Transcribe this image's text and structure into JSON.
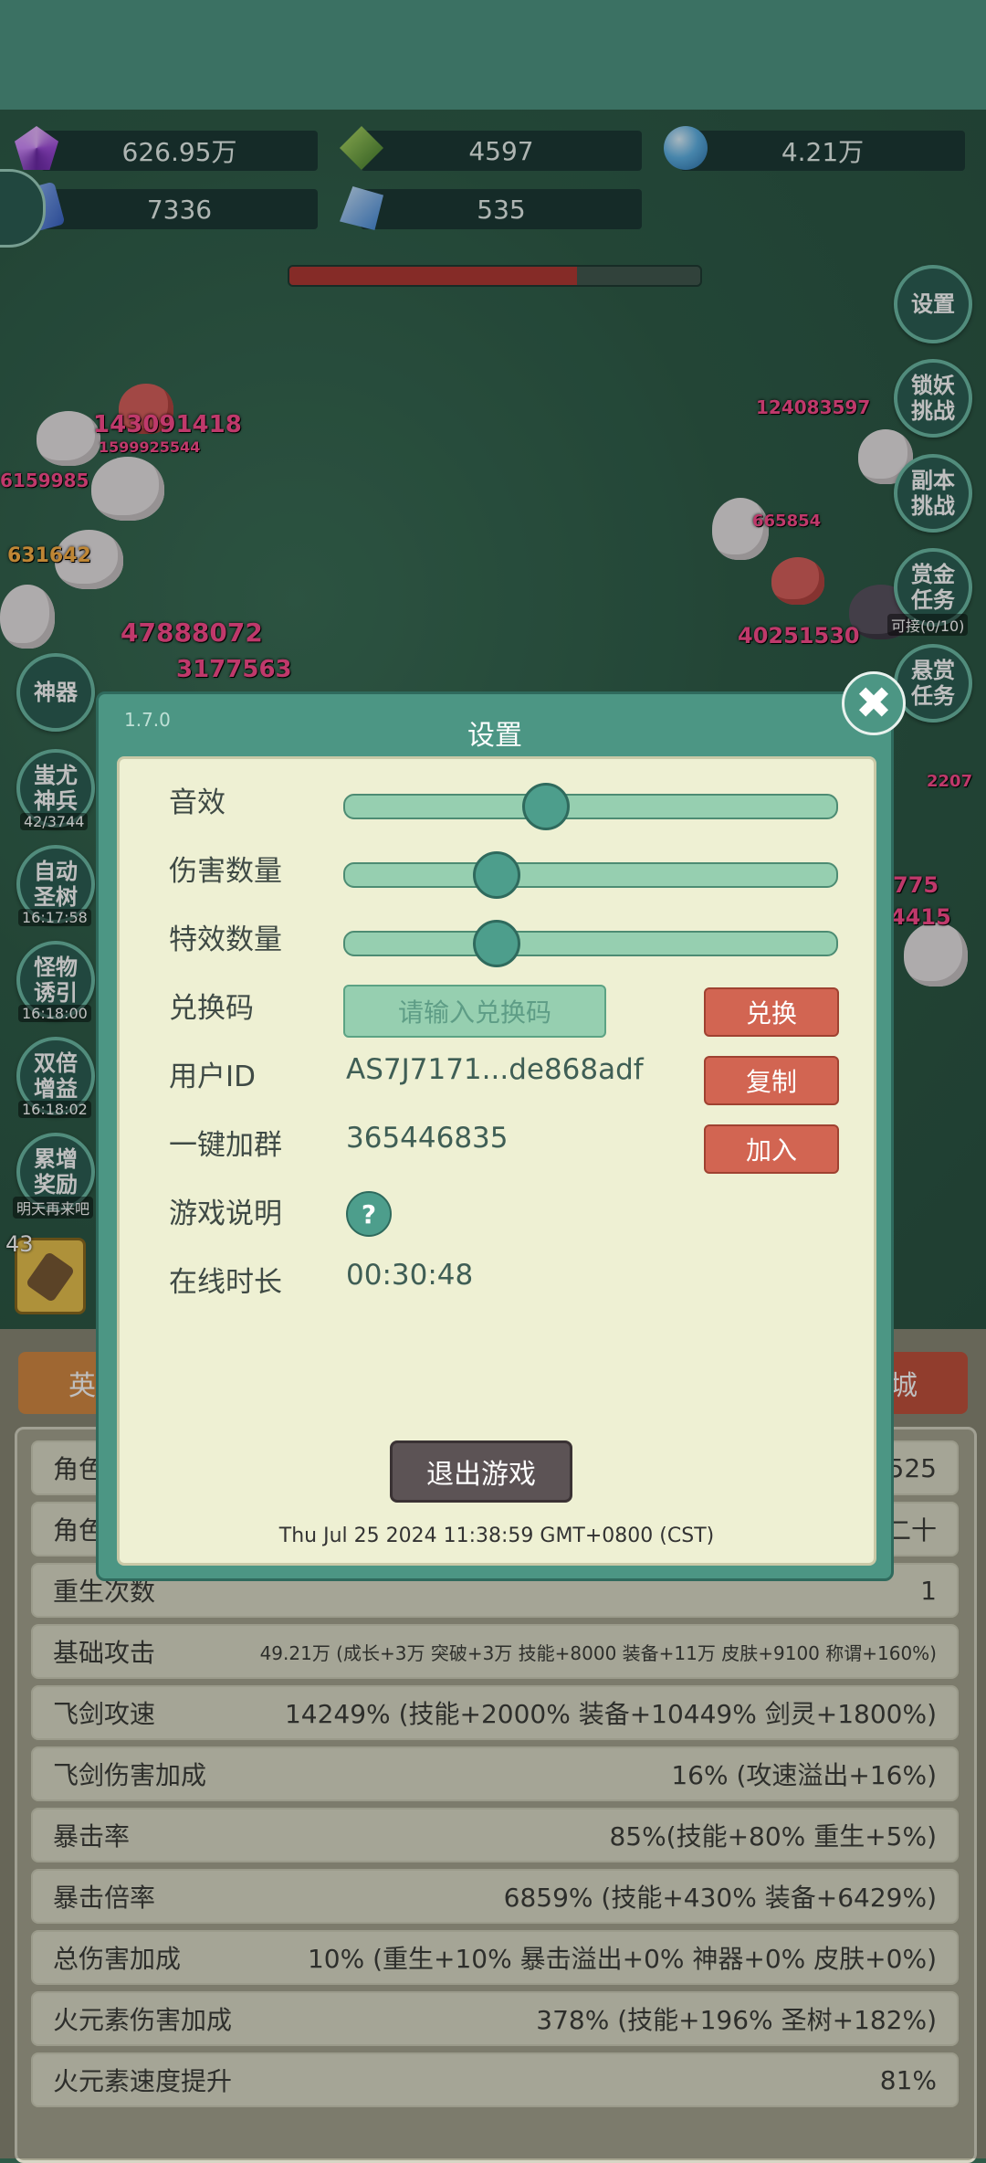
{
  "currencies": [
    {
      "icon": "purple-gem-icon",
      "value": "626.95万"
    },
    {
      "icon": "green-gem-icon",
      "value": "4597"
    },
    {
      "icon": "blue-orb-icon",
      "value": "4.21万"
    },
    {
      "icon": "blue-book-icon",
      "value": "7336"
    },
    {
      "icon": "blue-crystal-icon",
      "value": "535"
    }
  ],
  "boss_hp_fraction": 0.7,
  "side_right": [
    {
      "label": "设置"
    },
    {
      "label": "锁妖\n挑战"
    },
    {
      "label": "副本\n挑战"
    },
    {
      "label": "赏金\n任务",
      "sub": "可接(0/10)"
    },
    {
      "label": "悬赏\n任务"
    }
  ],
  "side_left": [
    {
      "label": "神器"
    },
    {
      "label": "蚩尤\n神兵",
      "sub": "42/3744"
    },
    {
      "label": "自动\n圣树",
      "sub": "16:17:58"
    },
    {
      "label": "怪物\n诱引",
      "sub": "16:18:00"
    },
    {
      "label": "双倍\n增益",
      "sub": "16:18:02"
    },
    {
      "label": "累增\n奖励",
      "sub": "明天再来吧"
    }
  ],
  "damage_numbers": [
    "143091418",
    "124083597",
    "6159985",
    "631642",
    "47888072",
    "3177563",
    "40251530",
    "665854",
    "1599925544",
    "2207",
    "775",
    "4415"
  ],
  "skill_level": "43",
  "tabs": {
    "left": "英",
    "right": "城"
  },
  "stats": [
    {
      "label": "角色",
      "value": "525"
    },
    {
      "label": "角色",
      "value": "二十"
    },
    {
      "label": "重生次数",
      "value": "1"
    },
    {
      "label": "基础攻击",
      "value": "49.21万 (成长+3万 突破+3万 技能+8000 装备+11万 皮肤+9100 称谓+160%)",
      "small": true
    },
    {
      "label": "飞剑攻速",
      "value": "14249% (技能+2000% 装备+10449% 剑灵+1800%)"
    },
    {
      "label": "飞剑伤害加成",
      "value": "16% (攻速溢出+16%)"
    },
    {
      "label": "暴击率",
      "value": "85%(技能+80% 重生+5%)"
    },
    {
      "label": "暴击倍率",
      "value": "6859% (技能+430% 装备+6429%)"
    },
    {
      "label": "总伤害加成",
      "value": "10% (重生+10% 暴击溢出+0% 神器+0% 皮肤+0%)"
    },
    {
      "label": "火元素伤害加成",
      "value": "378% (技能+196% 圣树+182%)"
    },
    {
      "label": "火元素速度提升",
      "value": "81%"
    }
  ],
  "dialog": {
    "version": "1.7.0",
    "title": "设置",
    "sound_label": "音效",
    "sound_level": 0.4,
    "damage_count_label": "伤害数量",
    "damage_count_level": 0.3,
    "effects_count_label": "特效数量",
    "effects_count_level": 0.3,
    "redeem_label": "兑换码",
    "redeem_placeholder": "请输入兑换码",
    "redeem_button": "兑换",
    "user_id_label": "用户ID",
    "user_id": "AS7J7171...de868adf",
    "copy_button": "复制",
    "group_label": "一键加群",
    "group_id": "365446835",
    "join_button": "加入",
    "help_label": "游戏说明",
    "help_icon": "?",
    "online_label": "在线时长",
    "online_time": "00:30:48",
    "exit_button": "退出游戏",
    "timestamp": "Thu Jul 25 2024 11:38:59 GMT+0800 (CST)",
    "close_icon": "✖"
  }
}
